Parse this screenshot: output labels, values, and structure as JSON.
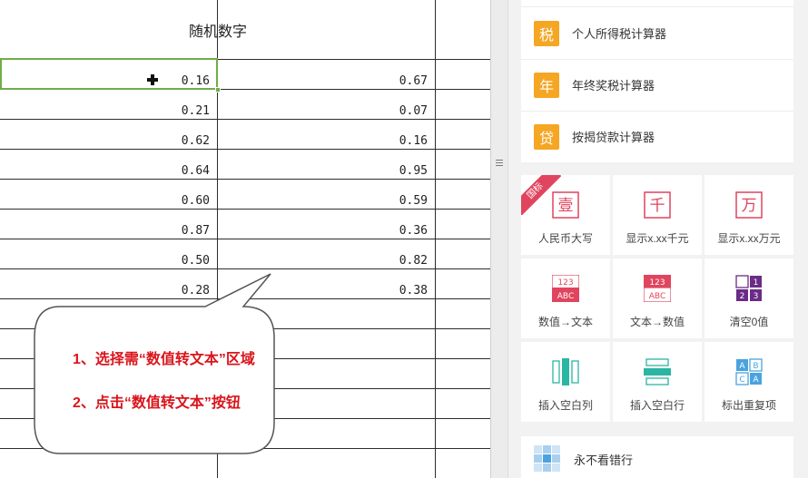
{
  "sheet": {
    "header_label": "随机数字",
    "col_a": [
      "0.16",
      "0.21",
      "0.62",
      "0.64",
      "0.60",
      "0.87",
      "0.50",
      "0.28"
    ],
    "col_b": [
      "0.67",
      "0.07",
      "0.16",
      "0.95",
      "0.59",
      "0.36",
      "0.82",
      "0.38"
    ]
  },
  "callout": {
    "line1": "1、选择需“数值转文本”区域",
    "line2": "2、点击“数值转文本”按钮",
    "text_color": "#d9141b"
  },
  "panel": {
    "calculators": [
      {
        "icon_char": "税",
        "label": "个人所得税计算器"
      },
      {
        "icon_char": "年",
        "label": "年终奖税计算器"
      },
      {
        "icon_char": "贷",
        "label": "按揭贷款计算器"
      }
    ],
    "ribbon_label": "国标",
    "tiles": [
      {
        "icon_text": "壹",
        "label": "人民币大写"
      },
      {
        "icon_text": "千",
        "label": "显示x.xx千元"
      },
      {
        "icon_text": "万",
        "label": "显示x.xx万元"
      },
      {
        "icon_top": "123",
        "icon_bottom": "ABC",
        "label": "数值→文本"
      },
      {
        "icon_top": "123",
        "icon_bottom": "ABC",
        "label": "文本→数值"
      },
      {
        "icon_cells": [
          "",
          "1",
          "2",
          "3"
        ],
        "label": "清空0值"
      },
      {
        "label": "插入空白列"
      },
      {
        "label": "插入空白行"
      },
      {
        "icon_cells": [
          "A",
          "B",
          "C",
          "A"
        ],
        "label": "标出重复项"
      }
    ],
    "bottom_label": "永不看错行",
    "accent_orange": "#f5a623",
    "accent_red": "#e0445e",
    "accent_teal": "#2bb5a3",
    "accent_purple": "#6a2c86",
    "accent_blue": "#4aa3df"
  }
}
